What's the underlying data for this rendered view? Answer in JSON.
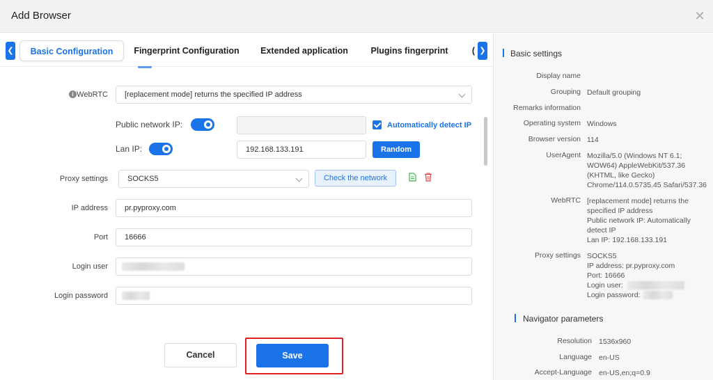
{
  "window": {
    "title": "Add Browser"
  },
  "tabs": [
    "Basic Configuration",
    "Fingerprint Configuration",
    "Extended application",
    "Plugins fingerprint"
  ],
  "form": {
    "webrtc_label": "WebRTC",
    "webrtc_value": "[replacement mode] returns the specified IP address",
    "public_ip_label": "Public network IP:",
    "auto_detect_label": "Automatically detect IP",
    "lan_ip_label": "Lan IP:",
    "lan_ip_value": "192.168.133.191",
    "random_label": "Random",
    "proxy_label": "Proxy settings",
    "proxy_value": "SOCKS5",
    "check_network_label": "Check the network",
    "ip_address_label": "IP address",
    "ip_address_value": "pr.pyproxy.com",
    "port_label": "Port",
    "port_value": "16666",
    "login_user_label": "Login user",
    "login_password_label": "Login password"
  },
  "footer": {
    "cancel_label": "Cancel",
    "save_label": "Save"
  },
  "summary": {
    "basic_heading": "Basic settings",
    "display_name_label": "Display name",
    "grouping_label": "Grouping",
    "grouping_value": "Default grouping",
    "remarks_label": "Remarks information",
    "os_label": "Operating system",
    "os_value": "Windows",
    "browser_version_label": "Browser version",
    "browser_version_value": "114",
    "useragent_label": "UserAgent",
    "useragent_lines": [
      "Mozilla/5.0 (Windows NT 6.1;",
      "WOW64) AppleWebKit/537.36",
      "(KHTML, like Gecko)",
      "Chrome/114.0.5735.45 Safari/537.36"
    ],
    "webrtc_label": "WebRTC",
    "webrtc_lines": [
      "[replacement mode] returns the",
      "specified IP address",
      "Public network IP:  Automatically",
      "detect IP",
      "Lan IP:  192.168.133.191"
    ],
    "proxy_label": "Proxy settings",
    "proxy_lines": [
      "SOCKS5",
      "IP address:  pr.pyproxy.com",
      "Port:  16666",
      "Login user:",
      "Login password:"
    ],
    "navigator_heading": "Navigator parameters",
    "resolution_label": "Resolution",
    "resolution_value": "1536x960",
    "language_label": "Language",
    "language_value": "en-US",
    "accept_language_label": "Accept-Language",
    "accept_language_value": "en-US,en;q=0.9"
  },
  "colors": {
    "accent": "#1a73e8",
    "highlight": "#e02020",
    "doc_icon": "#3cb34a",
    "delete_icon": "#e64545"
  }
}
